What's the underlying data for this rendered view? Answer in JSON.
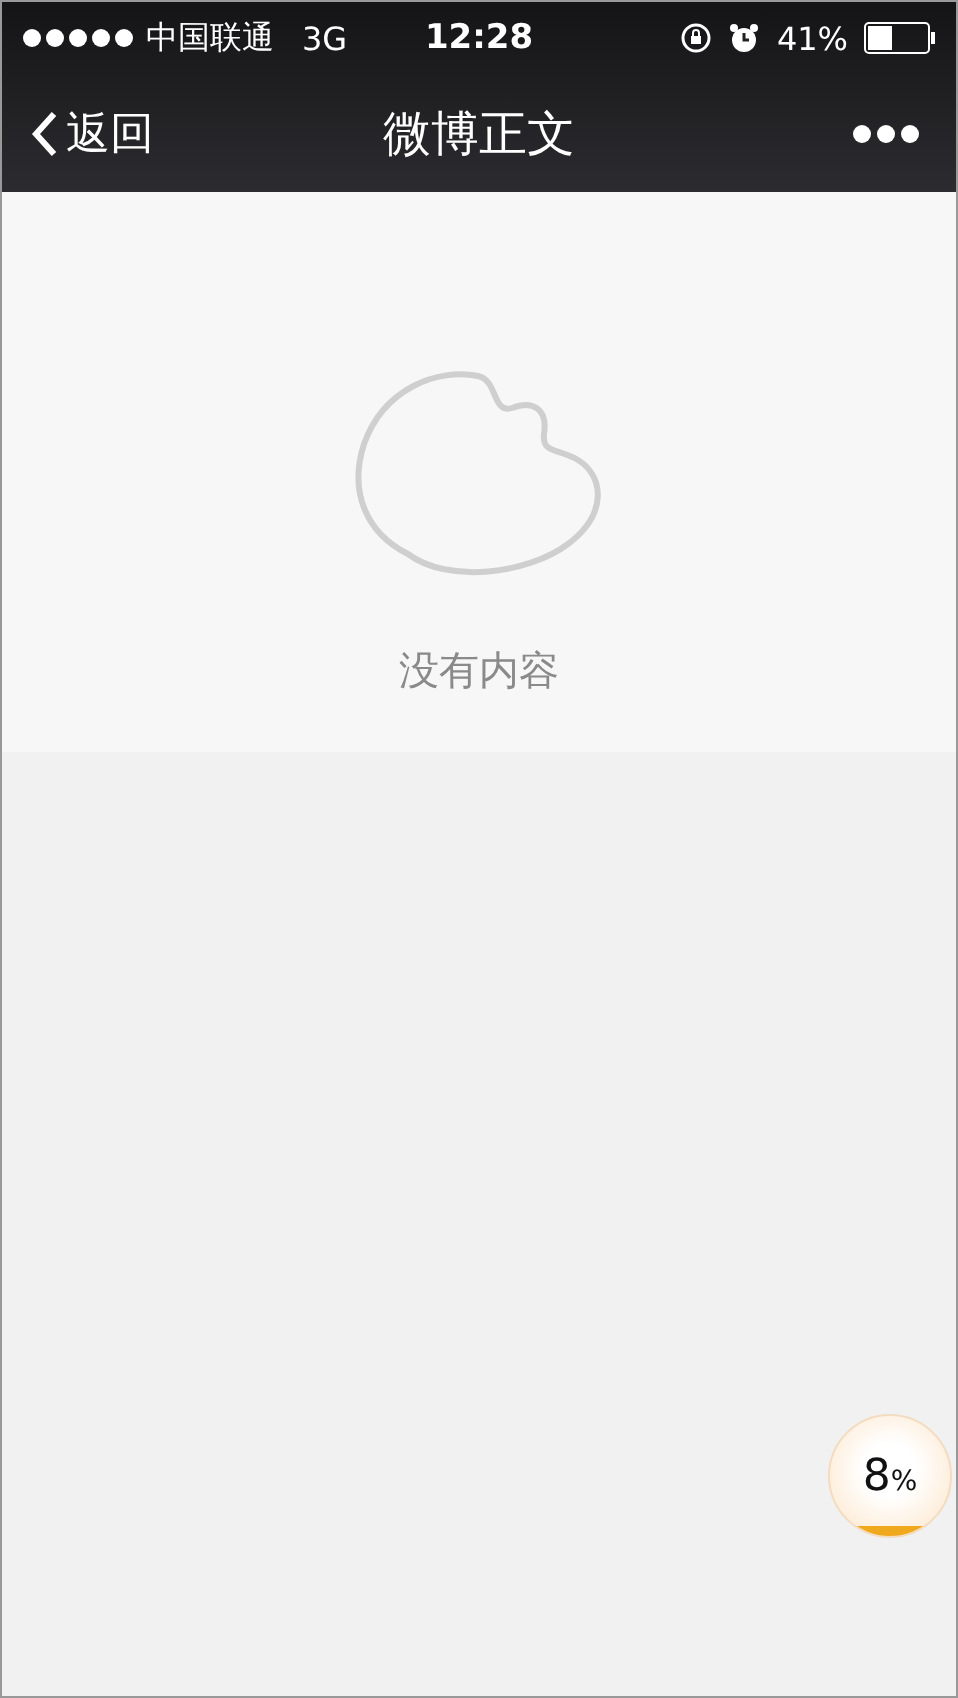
{
  "status_bar": {
    "carrier": "中国联通",
    "network": "3G",
    "time": "12:28",
    "battery_percent": "41%"
  },
  "nav_bar": {
    "back_label": "返回",
    "title": "微博正文"
  },
  "empty_state": {
    "message": "没有内容"
  },
  "progress_badge": {
    "value": "8",
    "unit": "%"
  }
}
